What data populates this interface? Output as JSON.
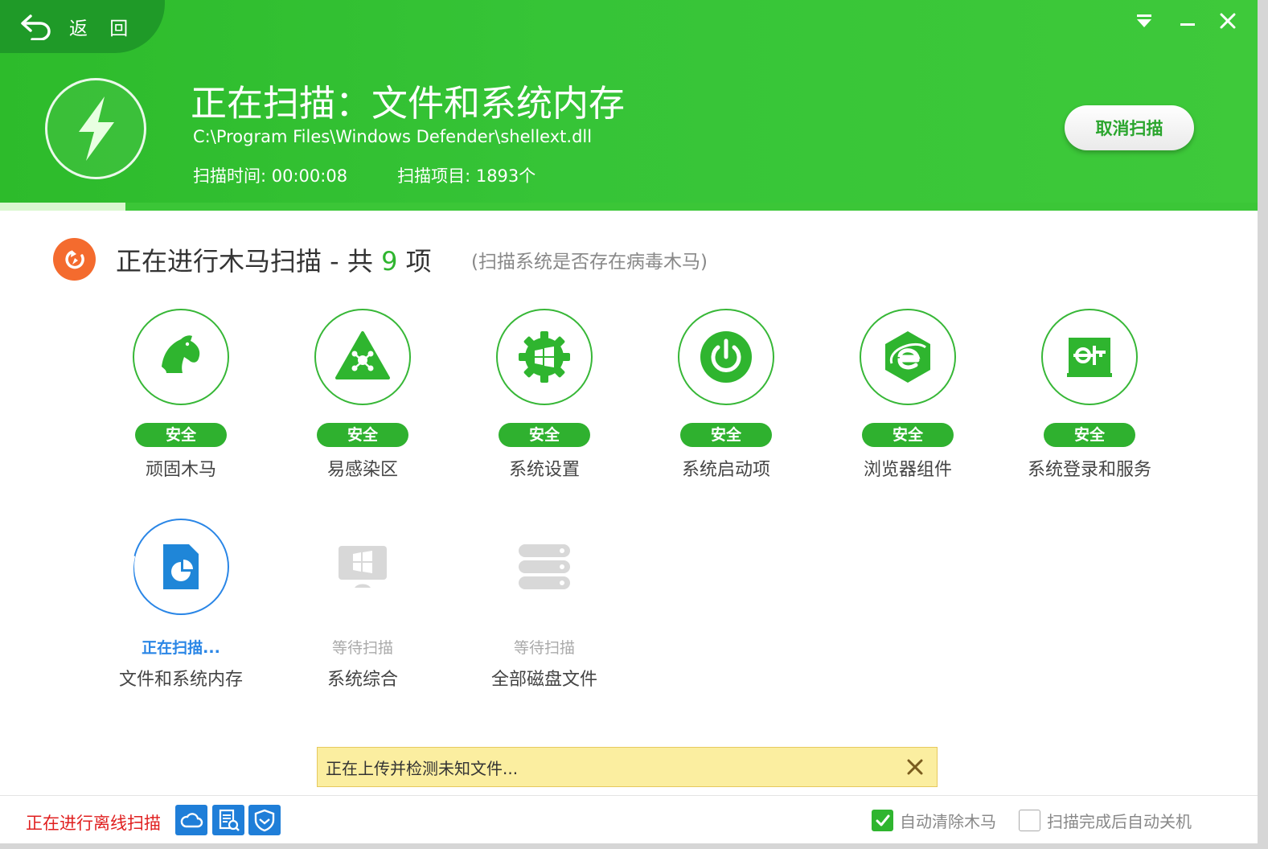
{
  "header": {
    "back_label": "返 回",
    "title": "正在扫描：文件和系统内存",
    "current_path": "C:\\Program Files\\Windows Defender\\shellext.dll",
    "scan_time_label": "扫描时间: 00:00:08",
    "scan_items_label": "扫描项目: 1893个",
    "cancel_button": "取消扫描",
    "progress_fraction": 0.1,
    "colors": {
      "header_green": "#36c437",
      "back_green": "#1f9a28"
    }
  },
  "section": {
    "title_prefix": "正在进行木马扫描 - 共",
    "count": "9",
    "title_suffix": "项",
    "subtitle": "(扫描系统是否存在病毒木马)"
  },
  "scan_items": [
    {
      "label": "顽固木马",
      "status": "安全",
      "icon": "horse-icon"
    },
    {
      "label": "易感染区",
      "status": "安全",
      "icon": "warning-triangle-icon"
    },
    {
      "label": "系统设置",
      "status": "安全",
      "icon": "windows-gear-icon"
    },
    {
      "label": "系统启动项",
      "status": "安全",
      "icon": "power-icon"
    },
    {
      "label": "浏览器组件",
      "status": "安全",
      "icon": "browser-e-icon"
    },
    {
      "label": "系统登录和服务",
      "status": "安全",
      "icon": "login-service-icon"
    },
    {
      "label": "文件和系统内存",
      "status": "正在扫描...",
      "icon": "file-chart-icon"
    },
    {
      "label": "系统综合",
      "status": "等待扫描",
      "icon": "windows-system-icon"
    },
    {
      "label": "全部磁盘文件",
      "status": "等待扫描",
      "icon": "disk-stack-icon"
    }
  ],
  "notice": {
    "text": "正在上传并检测未知文件..."
  },
  "footer": {
    "offline_text": "正在进行离线扫描",
    "icons": [
      "cloud-icon",
      "scan-doc-icon",
      "shield-icon"
    ],
    "auto_clean_label": "自动清除木马",
    "auto_clean_checked": true,
    "auto_shutdown_label": "扫描完成后自动关机",
    "auto_shutdown_checked": false
  }
}
